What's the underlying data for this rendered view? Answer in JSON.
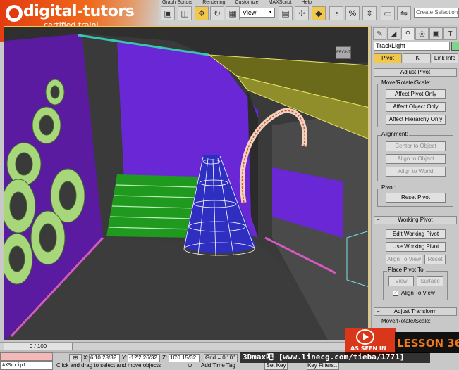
{
  "logo": {
    "name": "digital-tutors",
    "sub": "certified traini"
  },
  "menu": [
    "Graph Editors",
    "Rendering",
    "Customize",
    "MAXScript",
    "Help"
  ],
  "toolbar": {
    "view_select": "View",
    "selection_set_placeholder": "Create Selection S"
  },
  "viewport": {
    "viewcube_label": "FRONT"
  },
  "command_panel": {
    "object_name": "TrackLight",
    "object_color": "#7fd38a",
    "sub_tabs": [
      "Pivot",
      "IK",
      "Link Info"
    ],
    "adjust_pivot": {
      "title": "Adjust Pivot",
      "move_rotate_scale_label": "Move/Rotate/Scale:",
      "affect_pivot_only": "Affect Pivot Only",
      "affect_object_only": "Affect Object Only",
      "affect_hierarchy_only": "Affect Hierarchy Only",
      "alignment_label": "Alignment:",
      "center_to_object": "Center to Object",
      "align_to_object": "Align to Object",
      "align_to_world": "Align to World",
      "pivot_label": "Pivot:",
      "reset_pivot": "Reset Pivot"
    },
    "working_pivot": {
      "title": "Working Pivot",
      "edit_working_pivot": "Edit Working Pivot",
      "use_working_pivot": "Use Working Pivot",
      "align_to_view": "Align To View",
      "reset": "Reset",
      "place_pivot_label": "Place Pivot To:",
      "view": "View",
      "surface": "Surface",
      "align_to_view_check": "Align To View"
    },
    "adjust_transform": {
      "title": "Adjust Transform",
      "move_rotate_scale_label": "Move/Rotate/Scale:"
    }
  },
  "timeslider": {
    "label": "0 / 100"
  },
  "status": {
    "maxscript": "AXScript.",
    "prompt": "Click and drag to select and move objects",
    "x_label": "X:",
    "x_value": "6'10 28/32",
    "y_label": "Y:",
    "y_value": "-12'2 26/32",
    "z_label": "Z:",
    "z_value": "10'0 15/32",
    "grid": "Grid = 0'10\"",
    "add_time_tag": "Add Time Tag",
    "set_key": "Set Key",
    "key_filters": "Key Filters..."
  },
  "overlay": {
    "as_seen_in": "AS SEEN IN",
    "lesson": "LESSON 36",
    "watermark": "3Dmax吧 [www.linecg.com/tieba/1771]"
  }
}
